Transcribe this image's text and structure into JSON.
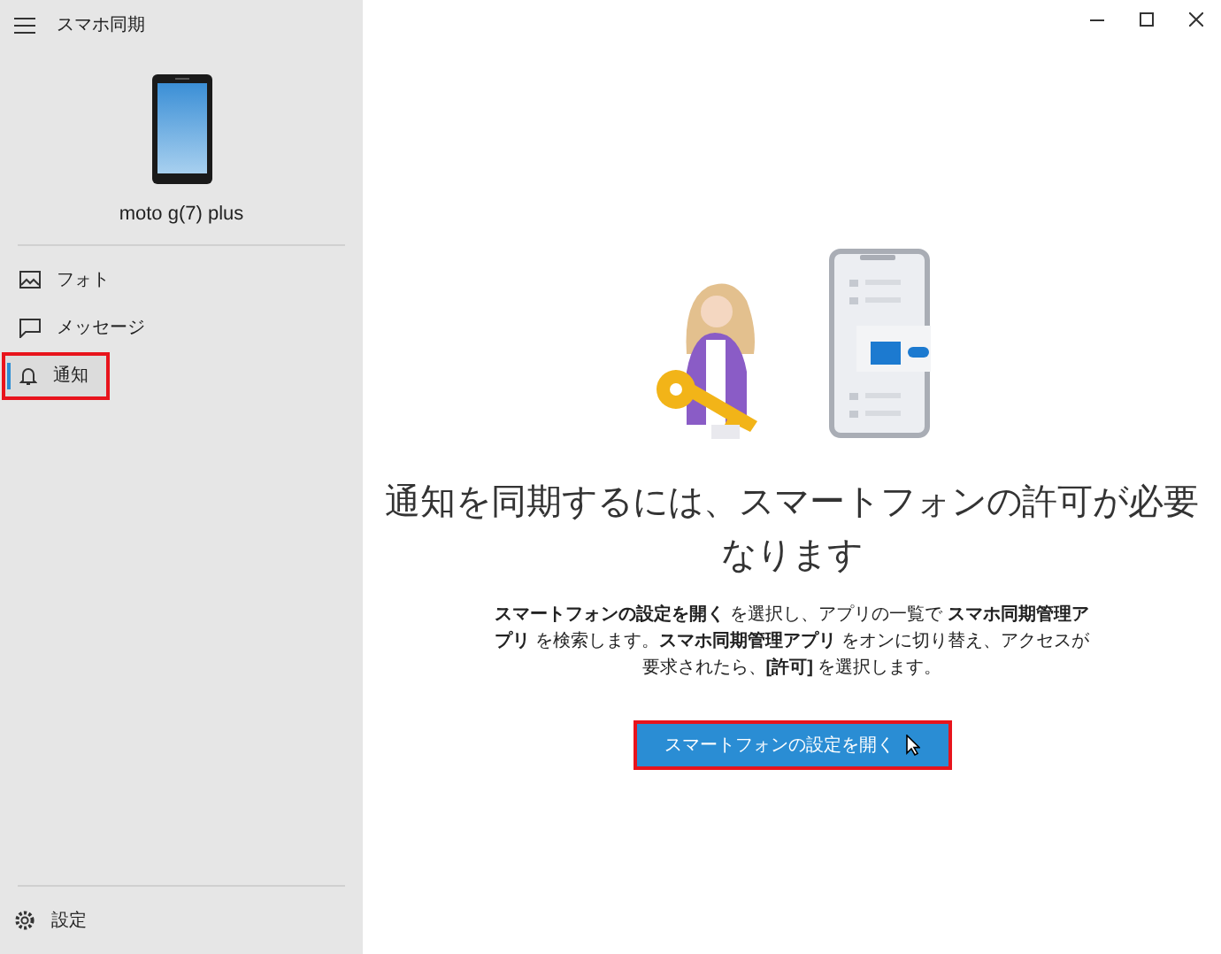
{
  "window": {
    "title": "スマホ同期"
  },
  "device": {
    "name": "moto g(7) plus"
  },
  "nav": [
    {
      "kind": "photos",
      "label": "フォト",
      "selected": false,
      "highlighted": false
    },
    {
      "kind": "messages",
      "label": "メッセージ",
      "selected": false,
      "highlighted": false
    },
    {
      "kind": "notifications",
      "label": "通知",
      "selected": true,
      "highlighted": true
    }
  ],
  "settings": {
    "label": "設定"
  },
  "main": {
    "heading_lines": [
      "通知を同期するには、スマートフォンの許可が必要",
      "なります"
    ],
    "instructions": "**スマートフォンの設定を開く** を選択し、アプリの一覧で **スマホ同期管理アプリ** を検索します。**スマホ同期管理アプリ** をオンに切り替え、アクセスが要求されたら、**[許可]** を選択します。",
    "button": {
      "label": "スマートフォンの設定を開く",
      "highlighted": true
    }
  }
}
